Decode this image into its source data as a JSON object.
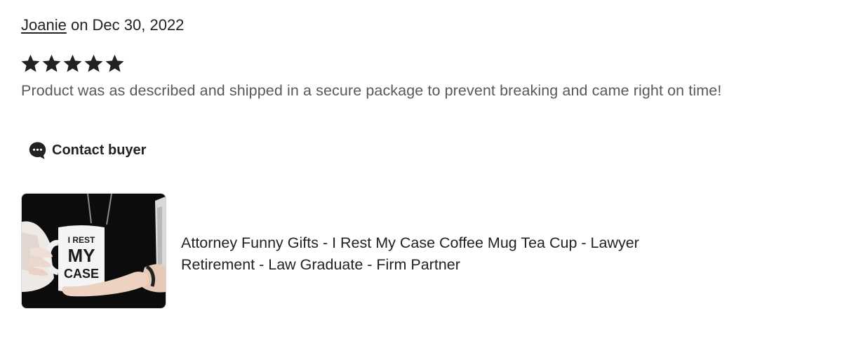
{
  "review": {
    "reviewer": "Joanie",
    "date_prefix": " on ",
    "date": "Dec 30, 2022",
    "rating": 5,
    "rating_max": 5,
    "text": "Product was as described and shipped in a secure package to prevent breaking and came right on time!"
  },
  "actions": {
    "contact_label": "Contact buyer",
    "contact_icon": "chat-bubble-icon"
  },
  "product": {
    "title": "Attorney Funny Gifts - I Rest My Case Coffee Mug Tea Cup - Lawyer Retirement - Law Graduate - Firm Partner",
    "image_text_line1": "I REST",
    "image_text_line2": "MY",
    "image_text_line3": "CASE"
  },
  "colors": {
    "star": "#222222",
    "text_primary": "#222222",
    "text_secondary": "#595959"
  }
}
